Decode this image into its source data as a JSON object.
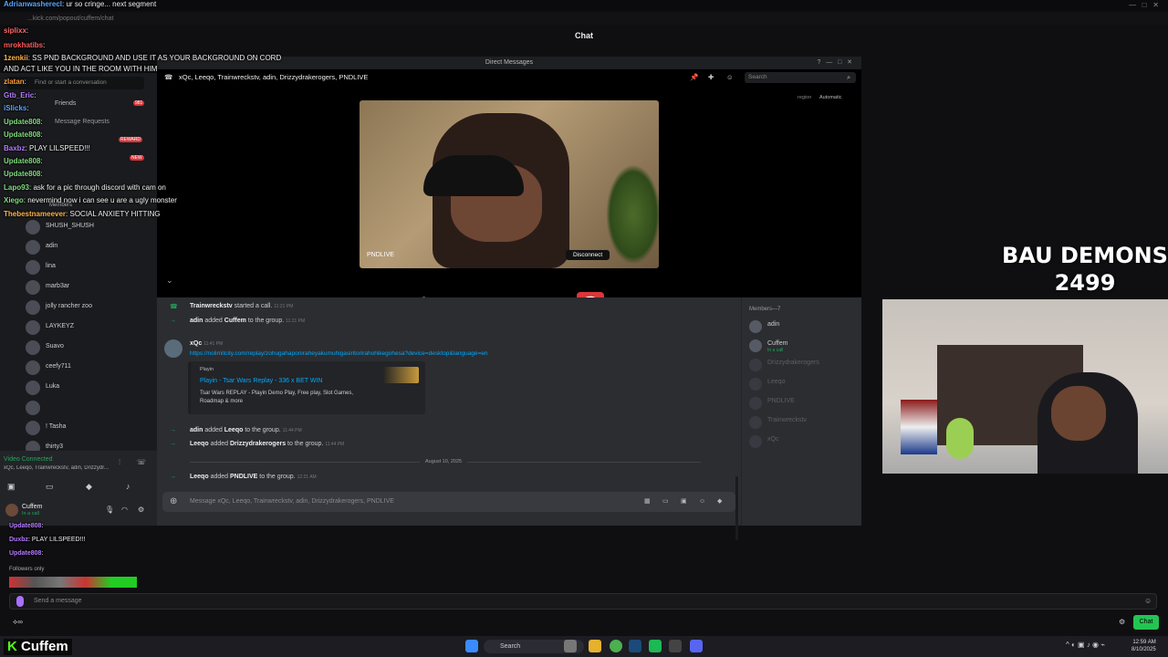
{
  "browser": {
    "url": "...kick.com/popout/cuffem/chat",
    "title": "Chat"
  },
  "chat_overlay": [
    {
      "user": "Adrianwasherecl",
      "msg": "ur so cringe... next segment",
      "color": "#59a5ff"
    },
    {
      "user": "siplixx",
      "msg": "",
      "color": "#ff6b6b"
    },
    {
      "user": "mrokhatibs",
      "msg": "",
      "color": "#ff5c5c"
    },
    {
      "user": "1zenkii",
      "msg": "SS PND BACKGROUND AND USE IT AS YOUR BACKGROUND ON CORD AND ACT LIKE YOU IN THE ROOM WITH HIM",
      "color": "#ffb347"
    },
    {
      "user": "zlatan",
      "msg": "",
      "color": "#ff9e3d"
    },
    {
      "user": "Gtb_Eric",
      "msg": "",
      "color": "#b57bff"
    },
    {
      "user": "iSlicks",
      "msg": "",
      "color": "#58a6ff"
    },
    {
      "user": "Update808",
      "msg": "",
      "color": "#7fdc7f"
    },
    {
      "user": "Update808",
      "msg": "",
      "color": "#7fdc7f"
    },
    {
      "user": "Baxbz",
      "msg": "PLAY LILSPEED!!!",
      "color": "#b57bff"
    },
    {
      "user": "Update808",
      "msg": "",
      "color": "#7fdc7f"
    },
    {
      "user": "Update808",
      "msg": "",
      "color": "#7fdc7f"
    },
    {
      "user": "Lapo93",
      "msg": "ask for a pic through discord with cam on",
      "color": "#7fdc7f"
    },
    {
      "user": "Xiego",
      "msg": "nevermind now i can see u are a ugly monster",
      "color": "#7fdc7f"
    },
    {
      "user": "Thebestnameever",
      "msg": "SOCIAL ANXIETY HITTING",
      "color": "#ffb347"
    }
  ],
  "chat_lower": [
    {
      "user": "Update808",
      "msg": ""
    },
    {
      "user": "Duxbz",
      "msg": "PLAY LILSPEED!!!"
    },
    {
      "user": "Update808",
      "msg": ""
    }
  ],
  "followers_only": "Followers only",
  "chat_input_placeholder": "Send a message",
  "chat_button": "Chat",
  "discord": {
    "window_title": "Direct Messages",
    "find_conv": "Find or start a conversation",
    "friends": "Friends",
    "message_requests": "Message Requests",
    "badge_count": "981",
    "badge_reward": "REWARD",
    "badge_new": "NEW",
    "dm_header": "xQc, Leeqo, Trainwreckstv, adin, Drizzydrakerogers, PNDLIVE",
    "search": "Search",
    "region_label": "region",
    "region_value": "Automatic",
    "video_name": "PNDLIVE",
    "disconnect": "Disconnect",
    "dm_list": [
      "SHUSH_SHUSH",
      "adin",
      "lina",
      "marb3ar",
      "jolly rancher zoo",
      "LAYKEYZ",
      "Suavo",
      "ceefy711",
      "Luka",
      "",
      "! Tasha",
      "thirty3"
    ],
    "dm_members_label": "Members",
    "video_connected": "Video Connected",
    "vc_sub": "xQc, Leeqo, Trainwreckstv, adin, Drizzydr...",
    "user_name": "Cuffem",
    "user_status": "In a call",
    "messages": {
      "call_line": {
        "user": "Trainwreckstv",
        "text": "started a call.",
        "time": "11:21 PM"
      },
      "added1": {
        "user": "adin",
        "text": "added",
        "target": "Cuffem",
        "suffix": "to the group.",
        "time": "11:21 PM"
      },
      "xqc": {
        "user": "xQc",
        "time": "11:41 PM",
        "link": "https://nolimitcity.com/replay/zohugahaponiraheyakumuhigasiritorirahohikegohesa?device=desktop&language=en"
      },
      "embed": {
        "provider": "Playin",
        "title": "Playin - Tsar Wars Replay - 336 x BET WIN",
        "desc": "Tsar Wars REPLAY - Playin Demo Play, Free play, Slot Games, Roadmap & more"
      },
      "added2": {
        "user": "adin",
        "text": "added",
        "target": "Leeqo",
        "suffix": "to the group.",
        "time": "11:44 PM"
      },
      "added3": {
        "user": "Leeqo",
        "text": "added",
        "target": "Drizzydrakerogers",
        "suffix": "to the group.",
        "time": "11:44 PM"
      },
      "date_divider": "August 10, 2025",
      "added4": {
        "user": "Leeqo",
        "text": "added",
        "target": "PNDLIVE",
        "suffix": "to the group.",
        "time": "12:21 AM"
      }
    },
    "input_placeholder": "Message xQc, Leeqo, Trainwreckstv, adin, Drizzydrakerogers, PNDLIVE",
    "members_header": "Members—7",
    "members": [
      {
        "name": "adin",
        "sub": ""
      },
      {
        "name": "Cuffem",
        "sub": "In a call"
      },
      {
        "name": "Drizzydrakerogers",
        "sub": ""
      },
      {
        "name": "Leeqo",
        "sub": ""
      },
      {
        "name": "PNDLIVE",
        "sub": ""
      },
      {
        "name": "Trainwreckstv",
        "sub": ""
      },
      {
        "name": "xQc",
        "sub": ""
      }
    ]
  },
  "overlay": {
    "title": "BAU DEMONS",
    "count": "2499"
  },
  "brand": {
    "k": "K",
    "name": "Cuffem"
  },
  "taskbar": {
    "search": "Search",
    "time": "12:59 AM",
    "date": "8/10/2025"
  }
}
